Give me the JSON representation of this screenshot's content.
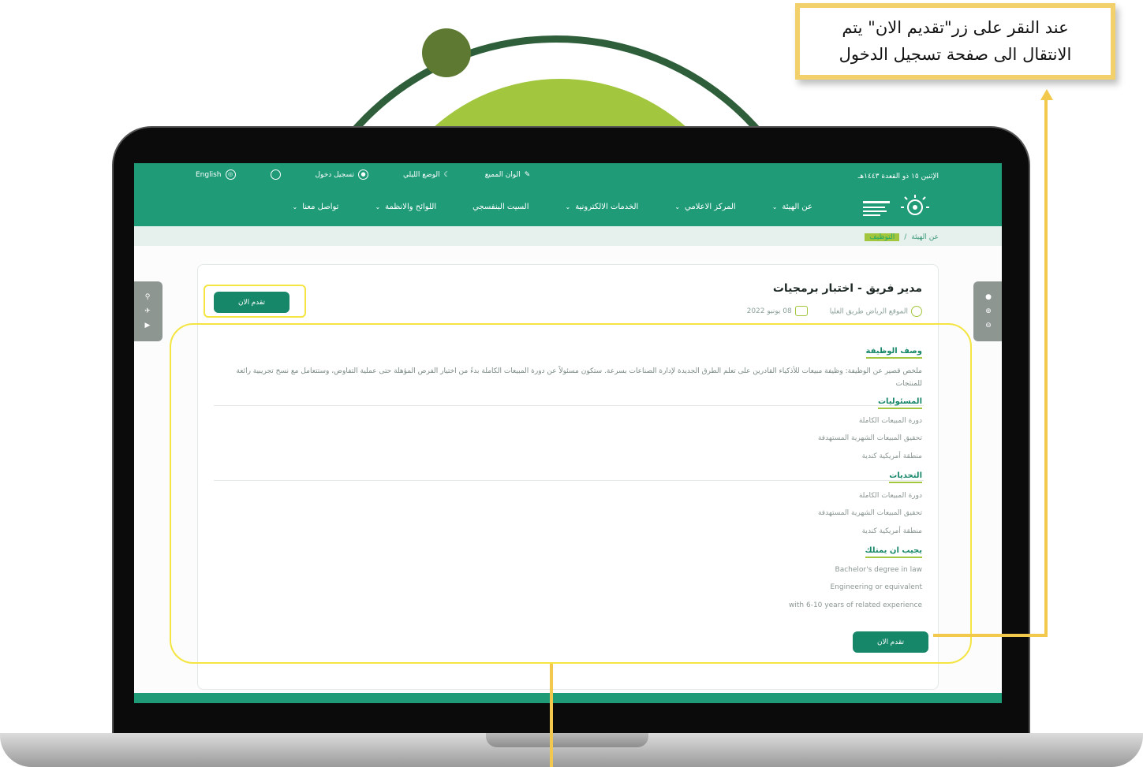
{
  "annotation": {
    "line1": "عند النقر على زر\"تقديم الان\" يتم",
    "line2": "الانتقال الى صفحة تسجيل الدخول"
  },
  "topbar": {
    "date": "الإثنين ١٥ ذو القعدة ١٤٤٣هـ",
    "language": "English",
    "login": "تسجيل دخول",
    "night_mode": "الوضع الليلي",
    "colors": "الوان المميع"
  },
  "nav": {
    "items": [
      "عن الهيئة",
      "المركز الاعلامي",
      "الخدمات الالكترونية",
      "السيت البنفسجي",
      "اللوائح والانظمة",
      "تواصل معنا"
    ]
  },
  "breadcrumb": {
    "root": "عن الهيئة",
    "sep": "/",
    "current": "التوظيف"
  },
  "job": {
    "title": "مدير فريق - اختبار برمجيات",
    "location": "الموقع الرياض طريق العليا",
    "date": "08 يونيو 2022",
    "apply_label": "تقدم الان"
  },
  "sections": {
    "description_title": "وصف الوظيفة",
    "description_text": "ملخص قصير عن الوظيفة: وظيفة مبيعات للأذكياء القادرين على تعلم الطرق الجديدة لإدارة الصناعات بسرعة. ستكون مسئولاً عن دورة المبيعات الكاملة بدءً من اختيار الفرص المؤهلة حتى عملية التفاوض، وستتعامل مع نسخ تجريبية رائعة للمنتجات",
    "responsibilities_title": "المسئوليات",
    "responsibilities": [
      "دورة المبيعات الكاملة",
      "تحقيق المبيعات الشهرية المستهدفة",
      "منطقة أمريكية كندية"
    ],
    "challenges_title": "التحديات",
    "challenges": [
      "دورة المبيعات الكاملة",
      "تحقيق المبيعات الشهرية المستهدفة",
      "منطقة أمريكية كندية"
    ],
    "requirements_title": "يجيب ان يمتلك",
    "requirements": [
      "Bachelor's degree in law",
      "Engineering or equivalent",
      "with 6-10 years of related experience"
    ]
  }
}
